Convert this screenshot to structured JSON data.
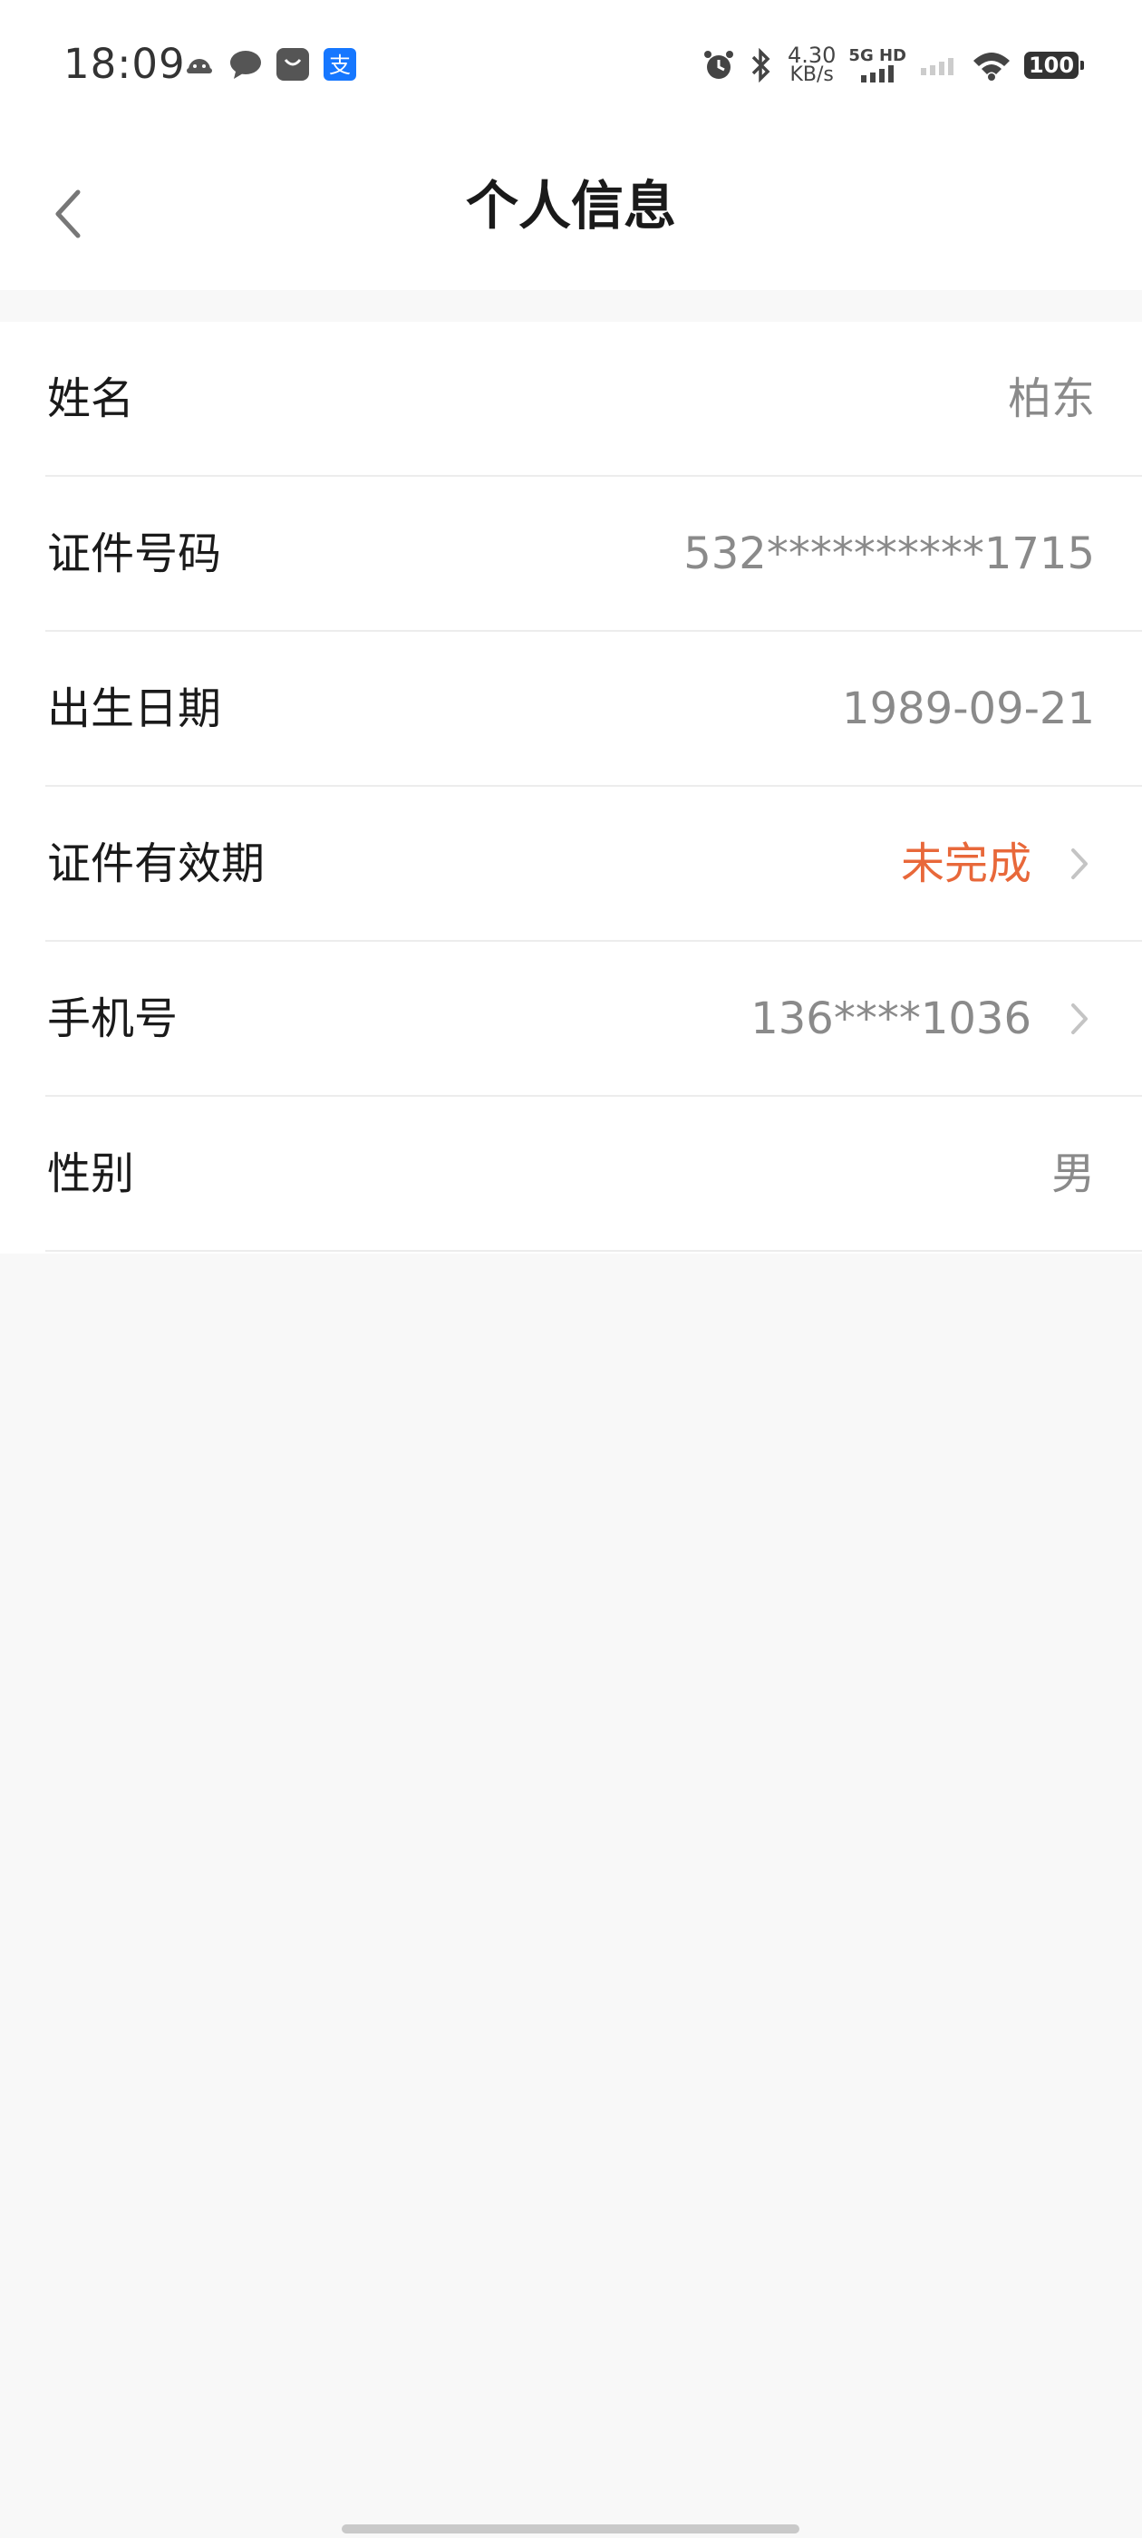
{
  "status_bar": {
    "time": "18:09",
    "net_speed_value": "4.30",
    "net_speed_unit": "KB/s",
    "network_label": "5G HD",
    "battery": "100",
    "icons": [
      "assistant-icon",
      "chat-icon",
      "taobao-icon",
      "alipay-icon",
      "alarm-icon",
      "bluetooth-icon",
      "signal-icon",
      "signal-weak-icon",
      "wifi-icon"
    ]
  },
  "header": {
    "title": "个人信息",
    "back_icon": "chevron-left-icon"
  },
  "info_rows": [
    {
      "label": "姓名",
      "value": "柏东",
      "has_chevron": false
    },
    {
      "label": "证件号码",
      "value": "532**********1715",
      "has_chevron": false
    },
    {
      "label": "出生日期",
      "value": "1989-09-21",
      "has_chevron": false
    },
    {
      "label": "证件有效期",
      "value": "未完成",
      "has_chevron": true,
      "value_color": "#e8683a"
    },
    {
      "label": "手机号",
      "value": "136****1036",
      "has_chevron": true
    },
    {
      "label": "性别",
      "value": "男",
      "has_chevron": false
    }
  ],
  "colors": {
    "accent_warning": "#e8683a",
    "value_gray": "#8a8a8a",
    "page_bg": "#f8f8f8"
  }
}
